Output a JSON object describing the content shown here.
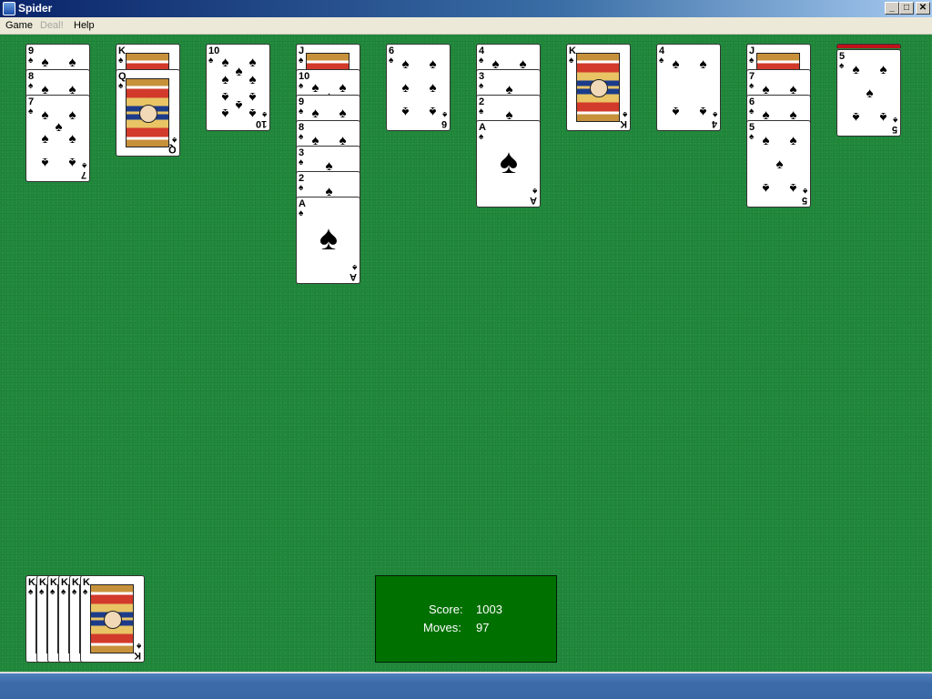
{
  "window": {
    "title": "Spider"
  },
  "window_buttons": {
    "minimize": "_",
    "maximize": "□",
    "close": "✕"
  },
  "menu": {
    "items": [
      "Game",
      "Deal!",
      "Help"
    ],
    "disabled": [
      false,
      true,
      false
    ]
  },
  "suit_symbol": "♠",
  "tableau": [
    {
      "cards": [
        "9",
        "8",
        "7"
      ]
    },
    {
      "cards": [
        "K",
        "Q"
      ]
    },
    {
      "cards": [
        "10"
      ]
    },
    {
      "cards": [
        "J",
        "10",
        "9",
        "8",
        "3",
        "2",
        "A"
      ]
    },
    {
      "cards": [
        "6"
      ]
    },
    {
      "cards": [
        "4",
        "3",
        "2",
        "A"
      ]
    },
    {
      "cards": [
        "K"
      ]
    },
    {
      "cards": [
        "4"
      ]
    },
    {
      "cards": [
        "J",
        "7",
        "6",
        "5"
      ]
    },
    {
      "cards": [
        "5"
      ],
      "face_down_above": true
    }
  ],
  "completed_stacks": [
    "K",
    "K",
    "K",
    "K",
    "K",
    "K"
  ],
  "score_panel": {
    "score_label": "Score:",
    "score_value": "1003",
    "moves_label": "Moves:",
    "moves_value": "97"
  },
  "colors": {
    "felt": "#218a3c",
    "score_panel": "#007000",
    "card_back": "#c0121a"
  }
}
